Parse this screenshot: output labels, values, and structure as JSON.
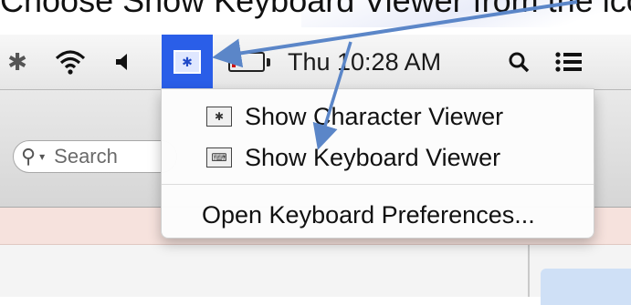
{
  "caption": {
    "text": "Choose Show Keyboard Viewer from the icon ",
    "red_text": "t"
  },
  "menubar": {
    "icons": [
      "bluetooth-icon",
      "wifi-icon",
      "volume-icon",
      "input-menu-icon",
      "battery-icon",
      "spotlight-icon",
      "notification-list-icon"
    ],
    "clock": "Thu 10:28 AM",
    "battery_level_percent": 12
  },
  "window": {
    "search_placeholder": "Search"
  },
  "dropdown": {
    "items": [
      {
        "label": "Show Character Viewer",
        "icon": "character-viewer-icon"
      },
      {
        "label": "Show Keyboard Viewer",
        "icon": "keyboard-viewer-icon"
      },
      {
        "label": "Open Keyboard Preferences..."
      }
    ]
  },
  "colors": {
    "accent": "#2a5ee8",
    "arrow": "#5b86c8",
    "battery_low": "#d01010"
  }
}
